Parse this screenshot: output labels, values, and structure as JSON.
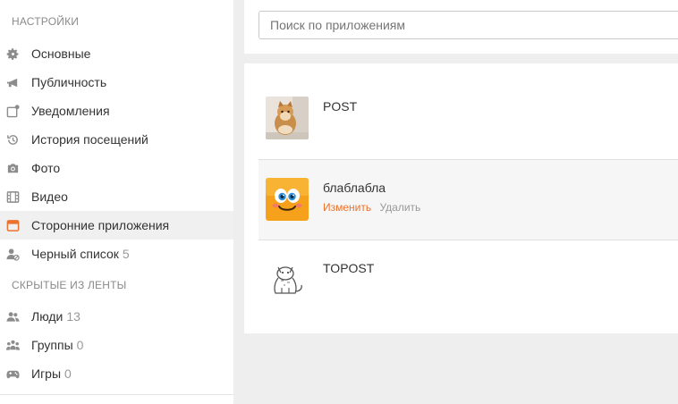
{
  "sidebar": {
    "settings_title": "НАСТРОЙКИ",
    "items": [
      {
        "label": "Основные",
        "count": "",
        "icon": "gear-icon"
      },
      {
        "label": "Публичность",
        "count": "",
        "icon": "megaphone-icon"
      },
      {
        "label": "Уведомления",
        "count": "",
        "icon": "notification-icon"
      },
      {
        "label": "История посещений",
        "count": "",
        "icon": "history-icon"
      },
      {
        "label": "Фото",
        "count": "",
        "icon": "camera-icon"
      },
      {
        "label": "Видео",
        "count": "",
        "icon": "film-icon"
      },
      {
        "label": "Сторонние приложения",
        "count": "",
        "icon": "apps-icon",
        "active": true
      },
      {
        "label": "Черный список",
        "count": "5",
        "icon": "blocked-user-icon"
      }
    ],
    "hidden_title": "СКРЫТЫЕ ИЗ ЛЕНТЫ",
    "hidden_items": [
      {
        "label": "Люди",
        "count": "13",
        "icon": "people-icon"
      },
      {
        "label": "Группы",
        "count": "0",
        "icon": "groups-icon"
      },
      {
        "label": "Игры",
        "count": "0",
        "icon": "gamepad-icon"
      }
    ]
  },
  "search": {
    "placeholder": "Поиск по приложениям"
  },
  "apps": [
    {
      "name": "POST",
      "thumb": "cat-photo"
    },
    {
      "name": "блаблабла",
      "thumb": "smiley",
      "edit_label": "Изменить",
      "delete_label": "Удалить"
    },
    {
      "name": "TOPOST",
      "thumb": "cat-sketch"
    }
  ],
  "colors": {
    "accent": "#eb722e",
    "icon_gray": "#8c8c8c",
    "active_bg": "#f0f0f0",
    "page_bg": "#eeeeee"
  }
}
